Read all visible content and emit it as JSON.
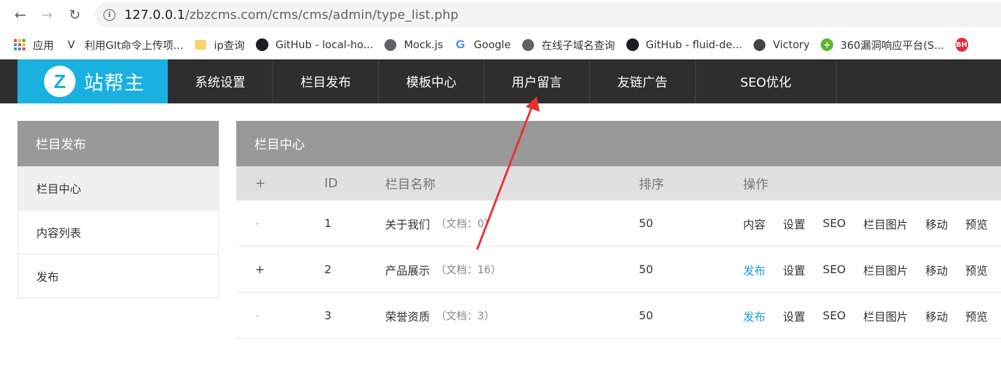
{
  "browser": {
    "url_host": "127.0.0.1",
    "url_path": "/zbzcms.com/cms/cms/admin/type_list.php"
  },
  "bookmarks": [
    {
      "label": "应用",
      "icon": "apps-grid-icon"
    },
    {
      "label": "利用GIt命令上传项...",
      "icon": "branch-icon"
    },
    {
      "label": "ip查询",
      "icon": "folder-icon"
    },
    {
      "label": "GitHub - local-ho...",
      "icon": "github-icon"
    },
    {
      "label": "Mock.js",
      "icon": "globe-icon"
    },
    {
      "label": "Google",
      "icon": "google-icon"
    },
    {
      "label": "在线子域名查询",
      "icon": "globe-icon"
    },
    {
      "label": "GitHub - fluid-de...",
      "icon": "github-icon"
    },
    {
      "label": "Victory",
      "icon": "victory-icon"
    },
    {
      "label": "360漏洞响应平台(S...",
      "icon": "360-icon"
    }
  ],
  "brand": {
    "letter": "Z",
    "name": "站帮主"
  },
  "topnav": [
    "系统设置",
    "栏目发布",
    "模板中心",
    "用户留言",
    "友链广告",
    "SEO优化"
  ],
  "sidebar": {
    "title": "栏目发布",
    "items": [
      "栏目中心",
      "内容列表",
      "发布"
    ]
  },
  "panel": {
    "title": "栏目中心",
    "headers": {
      "toggle": "+",
      "id": "ID",
      "name": "栏目名称",
      "sort": "排序",
      "actions": "操作"
    },
    "rows": [
      {
        "toggle": "-",
        "id": "1",
        "name": "关于我们",
        "doc": "（文档：0）",
        "sort": "50",
        "actions": [
          "内容",
          "设置",
          "SEO",
          "栏目图片",
          "移动",
          "预览"
        ]
      },
      {
        "toggle": "+",
        "id": "2",
        "name": "产品展示",
        "doc": "（文档：16）",
        "sort": "50",
        "actions": [
          "发布",
          "设置",
          "SEO",
          "栏目图片",
          "移动",
          "预览"
        ]
      },
      {
        "toggle": "-",
        "id": "3",
        "name": "荣誉资质",
        "doc": "（文档：3）",
        "sort": "50",
        "actions": [
          "发布",
          "设置",
          "SEO",
          "栏目图片",
          "移动",
          "预览"
        ]
      }
    ]
  },
  "colors": {
    "brand": "#1ab0e0",
    "link": "#1e9fd8",
    "arrow": "#e8322f"
  }
}
